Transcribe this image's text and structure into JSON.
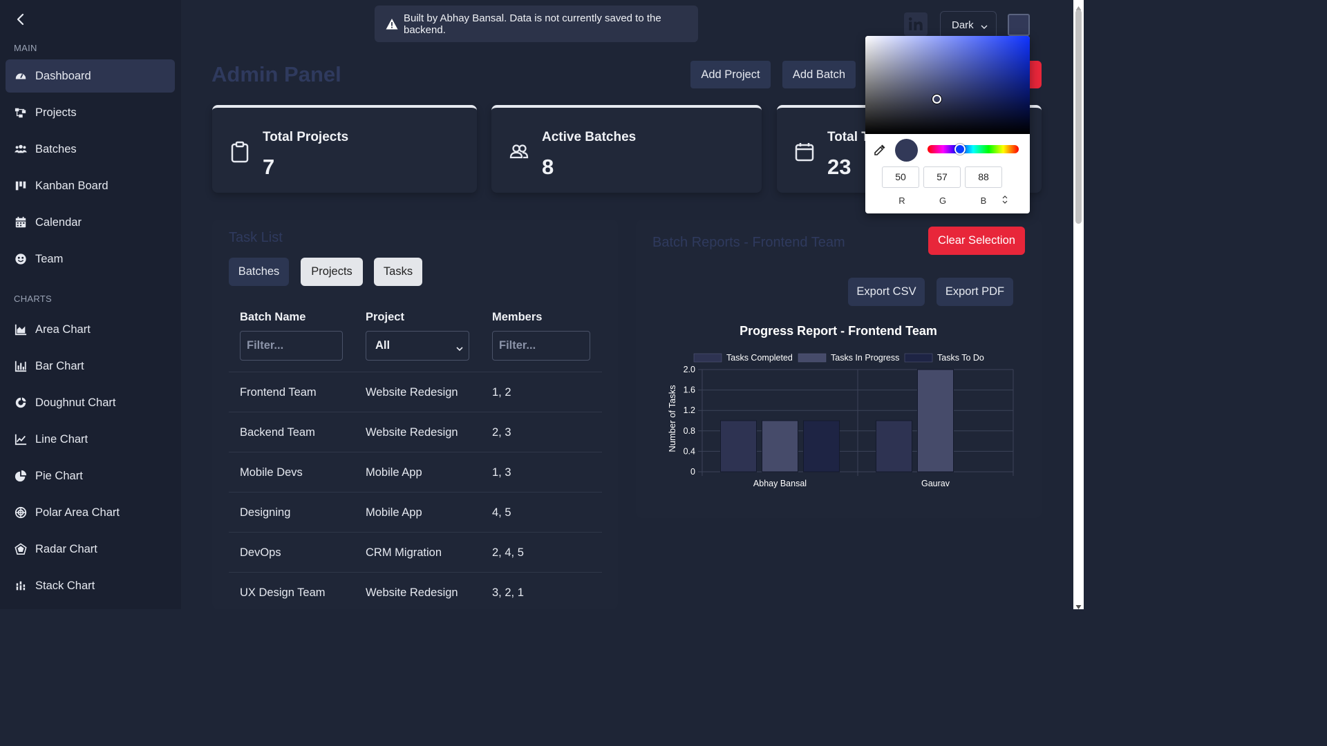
{
  "sidebar": {
    "main_label": "MAIN",
    "charts_label": "CHARTS",
    "main_items": [
      {
        "label": "Dashboard",
        "icon": "dashboard-icon"
      },
      {
        "label": "Projects",
        "icon": "projects-icon"
      },
      {
        "label": "Batches",
        "icon": "users-icon"
      },
      {
        "label": "Kanban Board",
        "icon": "kanban-icon"
      },
      {
        "label": "Calendar",
        "icon": "calendar-icon"
      },
      {
        "label": "Team",
        "icon": "team-icon"
      }
    ],
    "chart_items": [
      {
        "label": "Area Chart",
        "icon": "area-chart-icon"
      },
      {
        "label": "Bar Chart",
        "icon": "bar-chart-icon"
      },
      {
        "label": "Doughnut Chart",
        "icon": "doughnut-chart-icon"
      },
      {
        "label": "Line Chart",
        "icon": "line-chart-icon"
      },
      {
        "label": "Pie Chart",
        "icon": "pie-chart-icon"
      },
      {
        "label": "Polar Area Chart",
        "icon": "polar-area-chart-icon"
      },
      {
        "label": "Radar Chart",
        "icon": "radar-chart-icon"
      },
      {
        "label": "Stack Chart",
        "icon": "stack-chart-icon"
      }
    ]
  },
  "toast": {
    "text": "Built by Abhay Bansal. Data is not currently saved to the backend."
  },
  "header": {
    "theme_value": "Dark",
    "title": "Admin Panel",
    "add_project": "Add Project",
    "add_batch": "Add Batch"
  },
  "stats": [
    {
      "label": "Total Projects",
      "value": "7"
    },
    {
      "label": "Active Batches",
      "value": "8"
    },
    {
      "label": "Total T",
      "value": "23"
    }
  ],
  "task_list": {
    "title": "Task List",
    "tabs": [
      "Batches",
      "Projects",
      "Tasks"
    ],
    "headers": [
      "Batch Name",
      "Project",
      "Members"
    ],
    "filter_placeholder": "Filter...",
    "project_filter_value": "All",
    "rows": [
      [
        "Frontend Team",
        "Website Redesign",
        "1, 2"
      ],
      [
        "Backend Team",
        "Website Redesign",
        "2, 3"
      ],
      [
        "Mobile Devs",
        "Mobile App",
        "1, 3"
      ],
      [
        "Designing",
        "Mobile App",
        "4, 5"
      ],
      [
        "DevOps",
        "CRM Migration",
        "2, 4, 5"
      ],
      [
        "UX Design Team",
        "Website Redesign",
        "3, 2, 1"
      ]
    ]
  },
  "reports": {
    "title": "Batch Reports - Frontend Team",
    "clear_selection": "Clear Selection",
    "export_csv": "Export CSV",
    "export_pdf": "Export PDF"
  },
  "color_picker": {
    "r": "50",
    "g": "57",
    "b": "88",
    "r_label": "R",
    "g_label": "G",
    "b_label": "B",
    "selected_color": "#323958"
  },
  "colors": {
    "accent_red": "#e8263a",
    "button_dark": "#2c3652",
    "series_completed": "#2e3352",
    "series_in_progress": "#464b6a",
    "series_todo": "#1e2444"
  },
  "chart_data": {
    "type": "bar",
    "title": "Progress Report - Frontend Team",
    "categories": [
      "Abhay Bansal",
      "Gaurav"
    ],
    "series": [
      {
        "name": "Tasks Completed",
        "values": [
          1,
          1
        ]
      },
      {
        "name": "Tasks In Progress",
        "values": [
          1,
          2
        ]
      },
      {
        "name": "Tasks To Do",
        "values": [
          1,
          0
        ]
      }
    ],
    "xlabel": "",
    "ylabel": "Number of Tasks",
    "ylim": [
      0,
      2
    ],
    "yticks": [
      "0",
      "0.4",
      "0.8",
      "1.2",
      "1.6",
      "2.0"
    ],
    "legend": "top",
    "grid": true
  }
}
